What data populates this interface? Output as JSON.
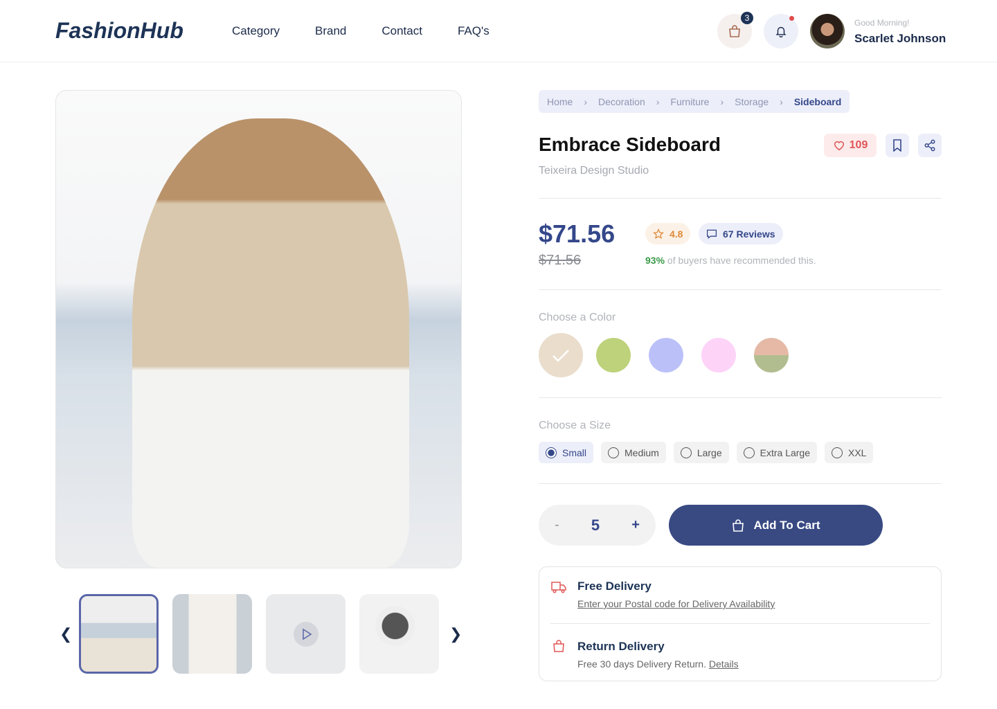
{
  "header": {
    "logo": "FashionHub",
    "nav": [
      "Category",
      "Brand",
      "Contact",
      "FAQ's"
    ],
    "cart_count": "3",
    "greeting": "Good Morning!",
    "user_name": "Scarlet Johnson"
  },
  "breadcrumb": [
    "Home",
    "Decoration",
    "Furniture",
    "Storage",
    "Sideboard"
  ],
  "product": {
    "title": "Embrace Sideboard",
    "studio": "Teixeira Design Studio",
    "likes": "109",
    "price": "$71.56",
    "old_price": "$71.56",
    "rating": "4.8",
    "reviews": "67 Reviews",
    "recommend_pct": "93%",
    "recommend_text": " of buyers have recommended this."
  },
  "colors": {
    "label": "Choose a Color",
    "swatches": [
      "#eaddcc",
      "#bdd27a",
      "#bbc1f8",
      "#fdd3f8",
      "#e5b9a6/#b1bd8f"
    ],
    "selected": 0
  },
  "sizes": {
    "label": "Choose a Size",
    "options": [
      "Small",
      "Medium",
      "Large",
      "Extra Large",
      "XXL"
    ],
    "selected": "Small"
  },
  "quantity": {
    "minus": "-",
    "value": "5",
    "plus": "+"
  },
  "add_to_cart": "Add To Cart",
  "delivery": {
    "free_title": "Free Delivery",
    "free_link": "Enter your Postal code for Delivery Availability",
    "return_title": "Return Delivery",
    "return_text": "Free 30 days Delivery Return. ",
    "return_link": "Details"
  },
  "accent": "#394a83"
}
